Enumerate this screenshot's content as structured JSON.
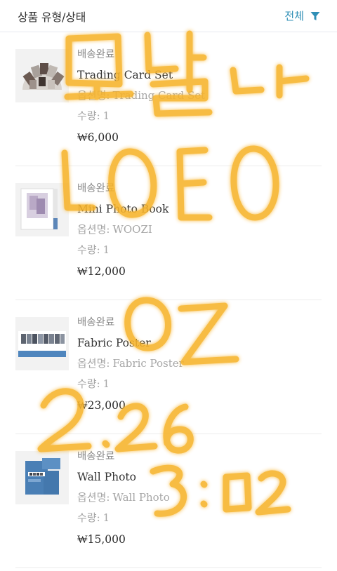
{
  "header": {
    "title": "상품 유형/상태",
    "filter_label": "전체",
    "filter_icon": "filter-icon",
    "accent": "#2f8fb6"
  },
  "orders": [
    {
      "status": "배송완료",
      "name": "Trading Card Set",
      "option_label": "옵션명:",
      "option_value": "Trading Card Set",
      "qty_label": "수량:",
      "qty_value": "1",
      "price": "₩6,000"
    },
    {
      "status": "배송완료",
      "name": "Mini Photo Book",
      "option_label": "옵션명:",
      "option_value": "WOOZI",
      "qty_label": "수량:",
      "qty_value": "1",
      "price": "₩12,000"
    },
    {
      "status": "배송완료",
      "name": "Fabric Poster",
      "option_label": "옵션명:",
      "option_value": "Fabric Poster",
      "qty_label": "수량:",
      "qty_value": "1",
      "price": "₩23,000"
    },
    {
      "status": "배송완료",
      "name": "Wall Photo",
      "option_label": "옵션명:",
      "option_value": "Wall Photo",
      "qty_label": "수량:",
      "qty_value": "1",
      "price": "₩15,000"
    }
  ],
  "overlay": {
    "handwriting": [
      "모날나",
      "LOEO",
      "OZ",
      "2.26",
      "3:02"
    ],
    "color": "#f7b32b"
  }
}
